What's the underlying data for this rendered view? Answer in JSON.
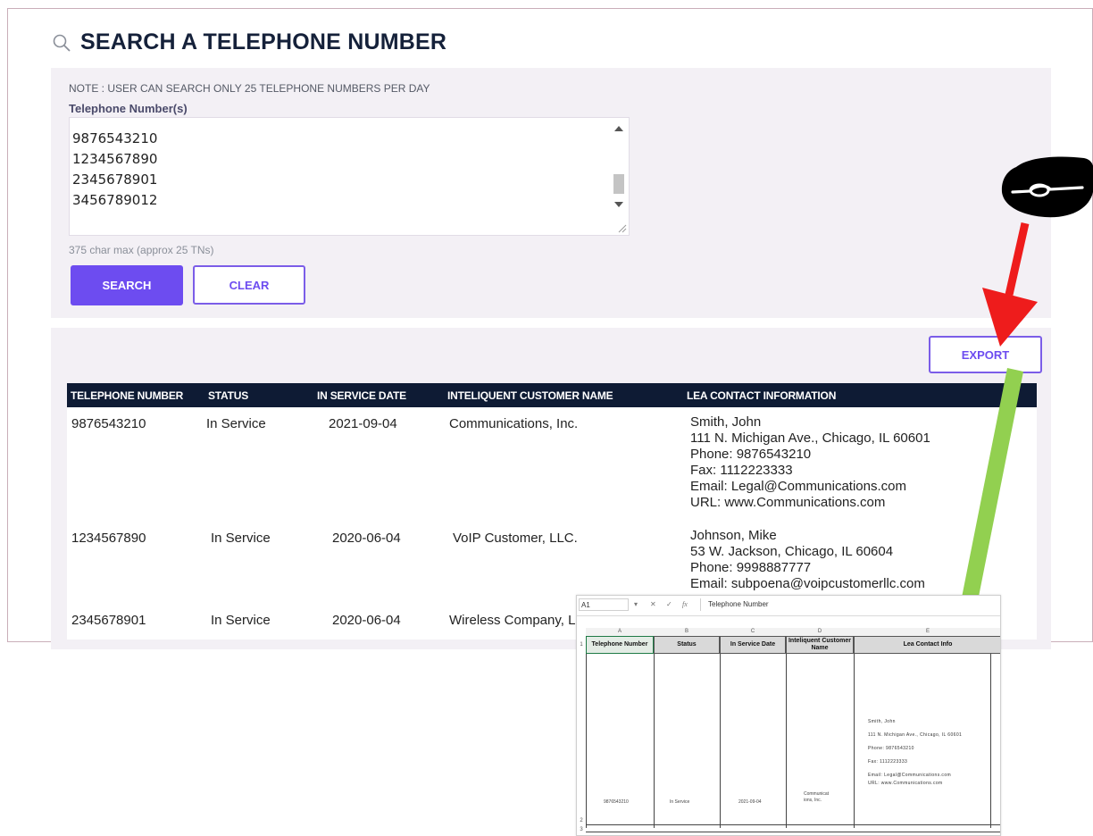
{
  "page": {
    "title": "SEARCH A TELEPHONE NUMBER",
    "note": "NOTE : USER CAN SEARCH ONLY 25 TELEPHONE NUMBERS PER DAY",
    "tn_label": "Telephone Number(s)",
    "tn_values": [
      "9876543210",
      "1234567890",
      "2345678901",
      "3456789012"
    ],
    "char_hint": "375 char max (approx 25 TNs)",
    "search_label": "SEARCH",
    "clear_label": "CLEAR",
    "export_label": "EXPORT"
  },
  "table": {
    "headers": [
      "TELEPHONE NUMBER",
      "STATUS",
      "IN SERVICE DATE",
      "INTELIQUENT CUSTOMER NAME",
      "LEA CONTACT INFORMATION"
    ],
    "rows": [
      {
        "tn": "9876543210",
        "status": "In Service",
        "date": "2021-09-04",
        "customer": "Communications, Inc.",
        "lea": [
          "Smith, John",
          "111 N. Michigan Ave., Chicago, IL 60601",
          "Phone:  9876543210",
          "Fax:  1112223333",
          "Email:  Legal@Communications.com",
          "URL:  www.Communications.com"
        ]
      },
      {
        "tn": "1234567890",
        "status": "In Service",
        "date": "2020-06-04",
        "customer": "VoIP Customer, LLC.",
        "lea": [
          "Johnson, Mike",
          "53 W. Jackson, Chicago, IL 60604",
          "Phone:  9998887777",
          "Email: subpoena@voipcustomerllc.com"
        ]
      },
      {
        "tn": "2345678901",
        "status": "In Service",
        "date": "2020-06-04",
        "customer": "Wireless Company, L"
      }
    ]
  },
  "excel": {
    "cell_ref": "A1",
    "formula_value": "Telephone Number",
    "col_letters": [
      "A",
      "B",
      "C",
      "D",
      "E"
    ],
    "headers": [
      "Telephone Number",
      "Status",
      "In Service Date",
      "Inteliquent Customer Name",
      "Lea Contact Info"
    ],
    "row_numbers": [
      "1",
      "2",
      "3"
    ],
    "row": {
      "tn": "9876543210",
      "status": "In Service",
      "date": "2021-09-04",
      "customer": "Communicat ions, Inc.",
      "lea": [
        "Smith, John",
        "111 N. Michigan Ave., Chicago, IL 60601",
        "Phone: 9876543210",
        "Fax: 1112223333",
        "Email: Legal@Communications.com",
        "URL: www.Communications.com"
      ]
    }
  },
  "colors": {
    "accent": "#6d4cf0",
    "table_header": "#0e1b34",
    "panel": "#f3f0f5",
    "red_arrow": "#ee1c1c",
    "green_arrow": "#92d050"
  }
}
